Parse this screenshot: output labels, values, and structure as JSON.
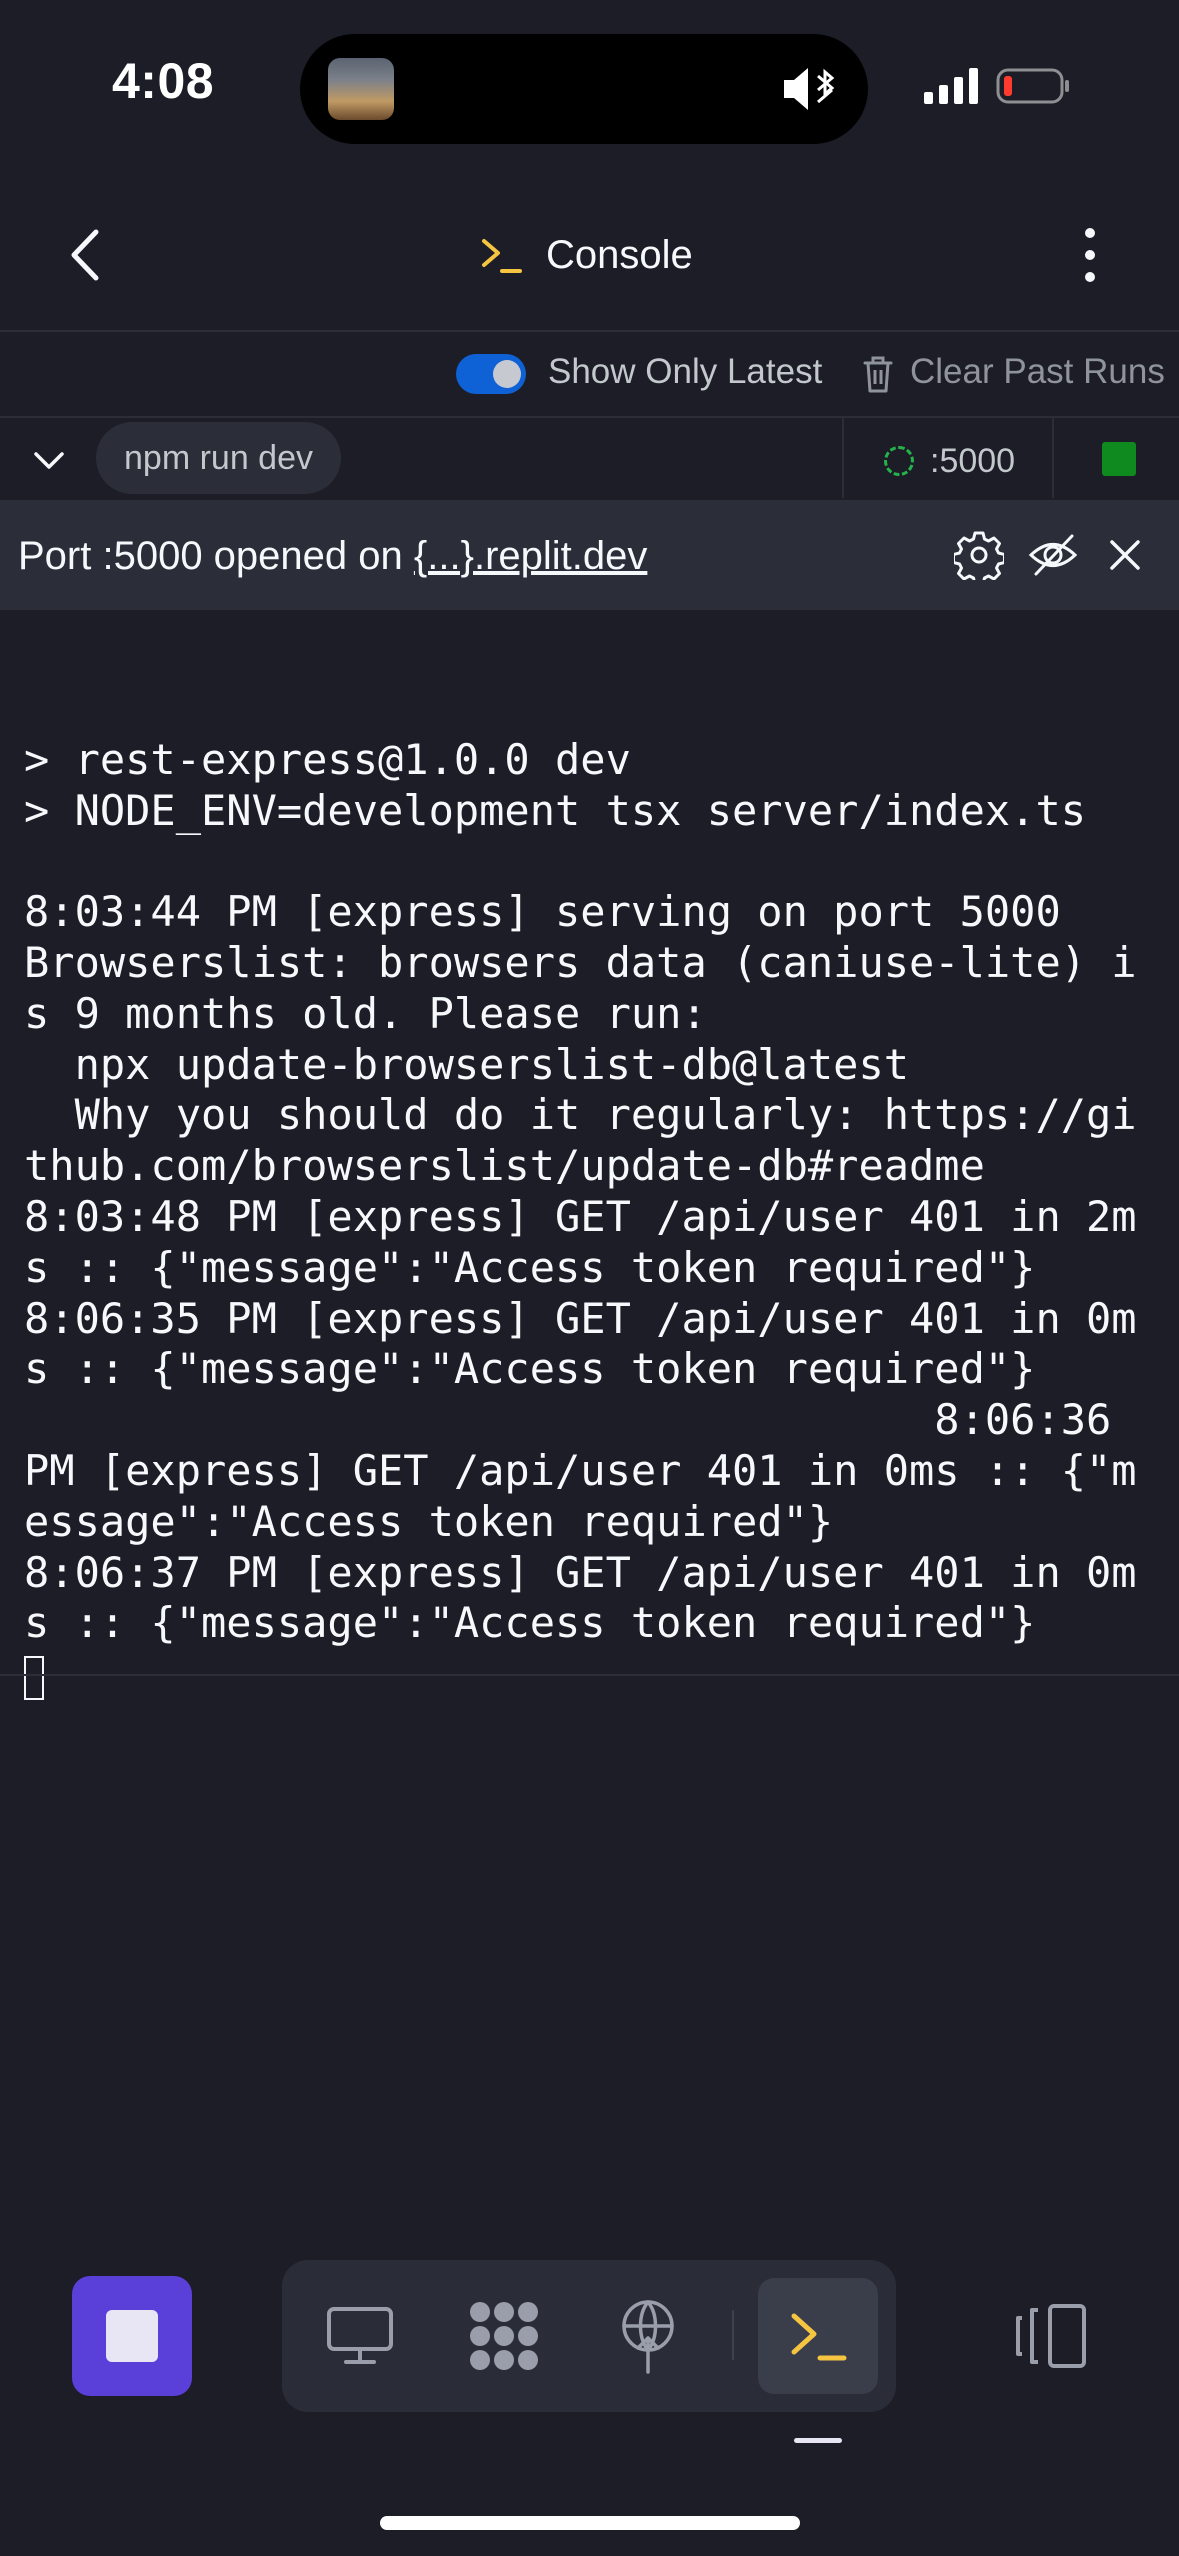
{
  "status_bar": {
    "time": "4:08"
  },
  "header": {
    "title": "Console"
  },
  "toolbar": {
    "show_latest_label": "Show Only Latest",
    "show_latest_on": true,
    "clear_label": "Clear Past Runs"
  },
  "run": {
    "command": "npm run dev",
    "port": ":5000"
  },
  "port_banner": {
    "prefix": "Port :5000 opened on ",
    "link": "{...}.replit.dev"
  },
  "console": {
    "lines": [
      "",
      "> rest-express@1.0.0 dev",
      "> NODE_ENV=development tsx server/index.ts",
      "",
      "8:03:44 PM [express] serving on port 5000",
      "Browserslist: browsers data (caniuse-lite) i",
      "s 9 months old. Please run:",
      "  npx update-browserslist-db@latest",
      "  Why you should do it regularly: https://gi",
      "thub.com/browserslist/update-db#readme",
      "8:03:48 PM [express] GET /api/user 401 in 2m",
      "s :: {\"message\":\"Access token required\"}",
      "8:06:35 PM [express] GET /api/user 401 in 0m",
      "s :: {\"message\":\"Access token required\"}",
      "                                    8:06:36",
      "PM [express] GET /api/user 401 in 0ms :: {\"m",
      "essage\":\"Access token required\"}",
      "8:06:37 PM [express] GET /api/user 401 in 0m",
      "s :: {\"message\":\"Access token required\"}"
    ]
  },
  "colors": {
    "background": "#1c1d26",
    "accent_purple": "#5b3fd9",
    "console_yellow": "#f5c542",
    "running_green": "#0e8a1e",
    "toggle_blue": "#0f62d6"
  },
  "icons": [
    "back-chevron-icon",
    "console-icon",
    "more-vertical-icon",
    "trash-icon",
    "chevron-down-icon",
    "settings-icon",
    "hide-icon",
    "close-icon",
    "stop-icon",
    "monitor-icon",
    "packages-icon",
    "deploy-icon",
    "panels-icon"
  ]
}
